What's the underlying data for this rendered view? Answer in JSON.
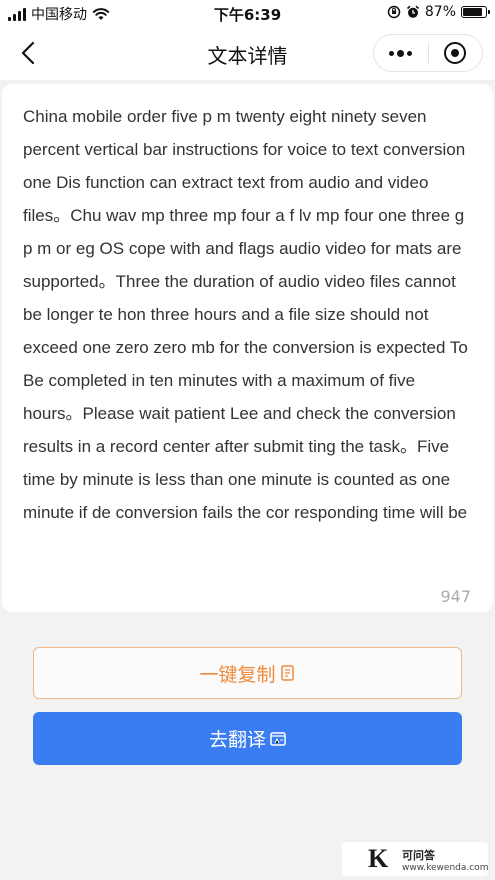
{
  "status_bar": {
    "carrier": "中国移动",
    "time": "下午6:39",
    "battery_percent_text": "87%",
    "battery_level": 0.87
  },
  "nav": {
    "title": "文本详情",
    "more_icon": "more-dots-icon",
    "close_icon": "target-circle-icon"
  },
  "content": {
    "text": "China mobile order five p m twenty eight ninety seven percent vertical bar instructions for voice to text conversion one Dis function can extract text from audio and video files。Chu wav mp three mp four a f lv mp four one three g p m or eg OS cope with and flags audio video for mats are supported。Three the duration of audio video files cannot be longer te hon three hours and a file size should not exceed one zero zero mb for the conversion is expected To Be completed in ten minutes with a maximum of five hours。Please wait patient Lee and check the conversion results in a record center after submit ting the task。Five time by minute is less than one minute is counted as one minute if de conversion fails the cor responding time will be",
    "char_count": "947"
  },
  "actions": {
    "copy_label": "一键复制",
    "translate_label": "去翻译"
  },
  "watermark": {
    "logo_letter": "K",
    "site_name": "可问答",
    "url": "www.kewenda.com"
  },
  "colors": {
    "accent_orange": "#f08a3c",
    "primary_blue": "#3a7df2",
    "background": "#f2f2f2"
  }
}
